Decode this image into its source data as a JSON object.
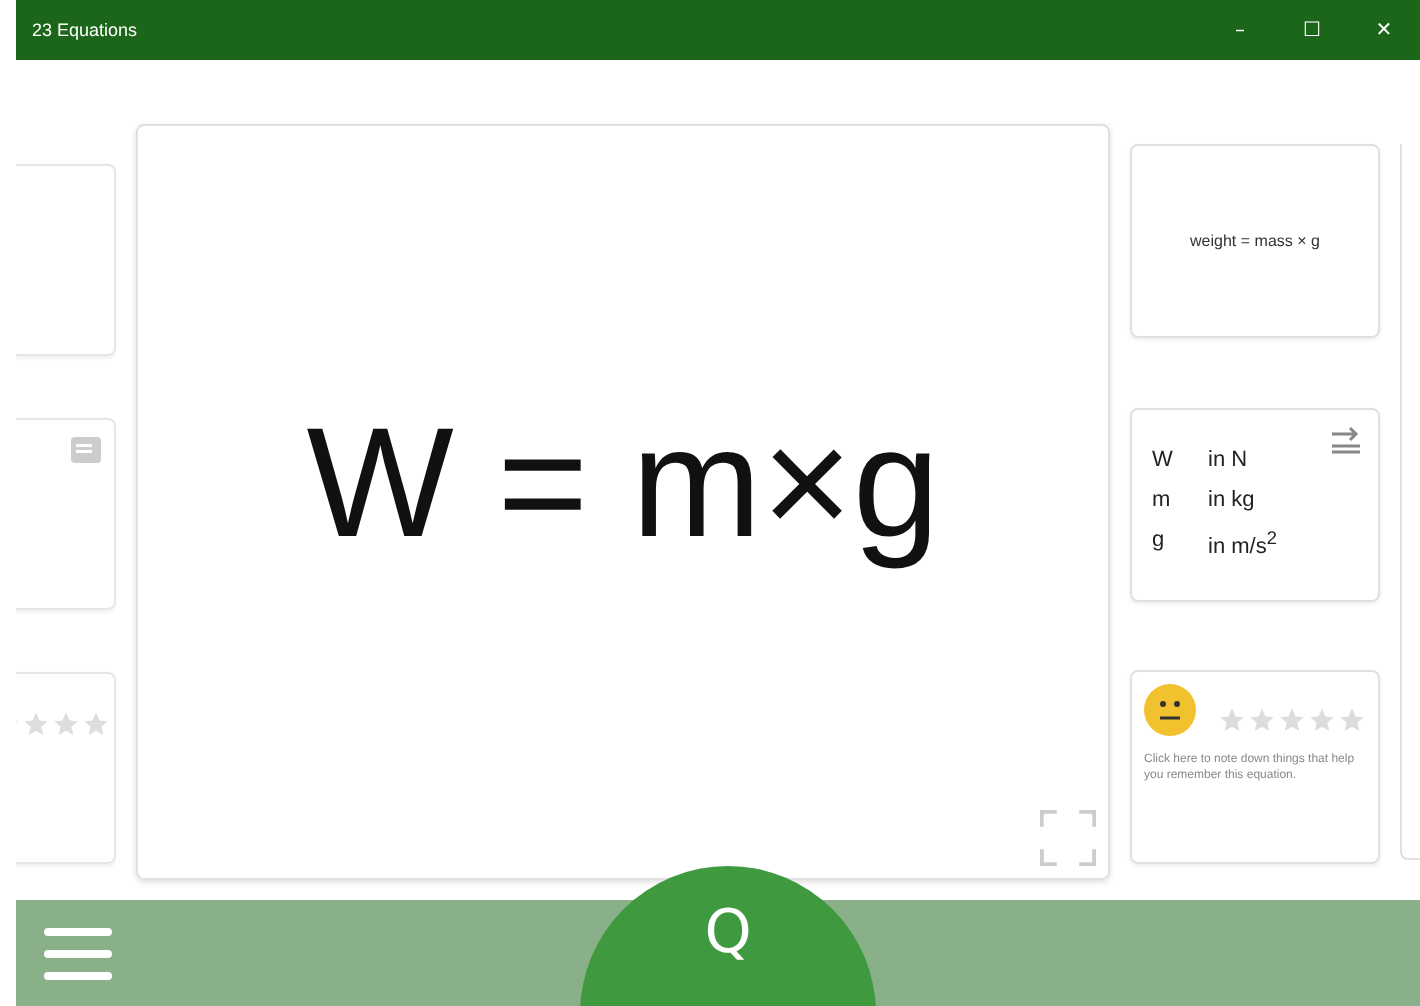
{
  "window": {
    "title": "23 Equations",
    "controls": [
      "–",
      "☐",
      "✕"
    ]
  },
  "main_card": {
    "equation": "W = m×g"
  },
  "word_card": {
    "text": "weight = mass × g"
  },
  "units_card": {
    "rows": [
      {
        "symbol": "W",
        "unit": "in N"
      },
      {
        "symbol": "m",
        "unit": "in kg"
      },
      {
        "symbol": "g",
        "unit": "in m/s$^{2}$"
      }
    ]
  },
  "notes_card": {
    "stars": 0,
    "note": "Click here to note down things that help you remember this equation."
  },
  "previous_card": {
    "stars": 0
  },
  "bottom_bar": {
    "quiz_button": "Q"
  }
}
